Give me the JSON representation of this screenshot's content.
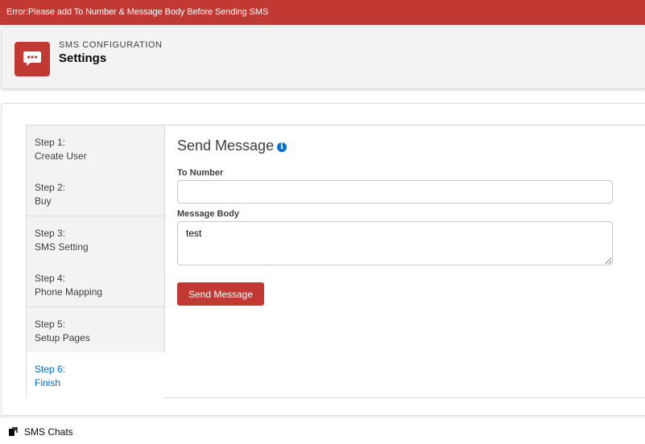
{
  "error": {
    "message": "Error:Please add To Number & Message Body Before Sending SMS"
  },
  "header": {
    "icon": "chat-bubble-icon",
    "subtitle": "SMS CONFIGURATION",
    "title": "Settings"
  },
  "steps": [
    {
      "step": "Step 1:",
      "name": "Create User",
      "active": false
    },
    {
      "step": "Step 2:",
      "name": "Buy",
      "active": false
    },
    {
      "step": "Step 3:",
      "name": "SMS Setting",
      "active": false
    },
    {
      "step": "Step 4:",
      "name": "Phone Mapping",
      "active": false
    },
    {
      "step": "Step 5:",
      "name": "Setup Pages",
      "active": false
    },
    {
      "step": "Step 6:",
      "name": "Finish",
      "active": true
    }
  ],
  "form": {
    "title": "Send Message",
    "info_icon": "info-icon",
    "to_number_label": "To Number",
    "to_number_value": "",
    "message_body_label": "Message Body",
    "message_body_value": "test",
    "send_label": "Send Message"
  },
  "footer": {
    "item_label": "SMS Chats",
    "item_icon": "chat-popout-icon"
  },
  "colors": {
    "error": "#c23934",
    "brand": "#c23934",
    "active_step": "#006dcc",
    "info": "#0070d2"
  }
}
